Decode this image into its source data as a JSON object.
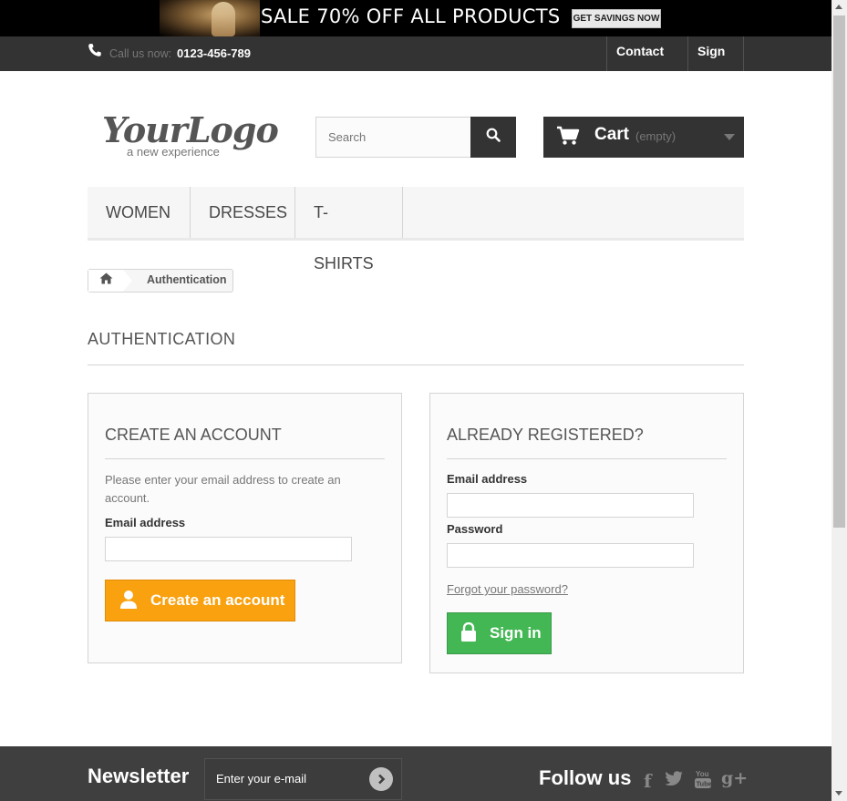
{
  "banner": {
    "text": "SALE 70% OFF ALL PRODUCTS",
    "button_label": "GET SAVINGS NOW"
  },
  "topnav": {
    "call_label": "Call us now:",
    "phone": "0123-456-789",
    "contact_label": "Contact us",
    "signin_label": "Sign in"
  },
  "header": {
    "logo_main": "YourLogo",
    "logo_sub": "a new experience",
    "search_placeholder": "Search",
    "cart_label": "Cart",
    "cart_status": "(empty)"
  },
  "menu": {
    "items": [
      {
        "label": "WOMEN"
      },
      {
        "label": "DRESSES"
      },
      {
        "label": "T-SHIRTS"
      }
    ]
  },
  "breadcrumb": {
    "current": "Authentication"
  },
  "page": {
    "heading": "AUTHENTICATION"
  },
  "create_account": {
    "title": "CREATE AN ACCOUNT",
    "description": "Please enter your email address to create an account.",
    "email_label": "Email address",
    "email_value": "",
    "button_label": "Create an account"
  },
  "login": {
    "title": "ALREADY REGISTERED?",
    "email_label": "Email address",
    "email_value": "",
    "password_label": "Password",
    "password_value": "",
    "forgot_label": "Forgot your password?",
    "button_label": "Sign in"
  },
  "footer": {
    "newsletter_title": "Newsletter",
    "newsletter_placeholder": "Enter your e-mail",
    "follow_title": "Follow us",
    "social": [
      {
        "icon": "facebook-icon",
        "glyph": "f"
      },
      {
        "icon": "twitter-icon",
        "glyph": "t"
      },
      {
        "icon": "youtube-icon",
        "glyph": "You Tube"
      },
      {
        "icon": "google-plus-icon",
        "glyph": "g+"
      }
    ]
  },
  "colors": {
    "dark_bar": "#333333",
    "orange_button": "#f9a10f",
    "green_button": "#43b754",
    "footer_bg": "#3f3f3f"
  }
}
